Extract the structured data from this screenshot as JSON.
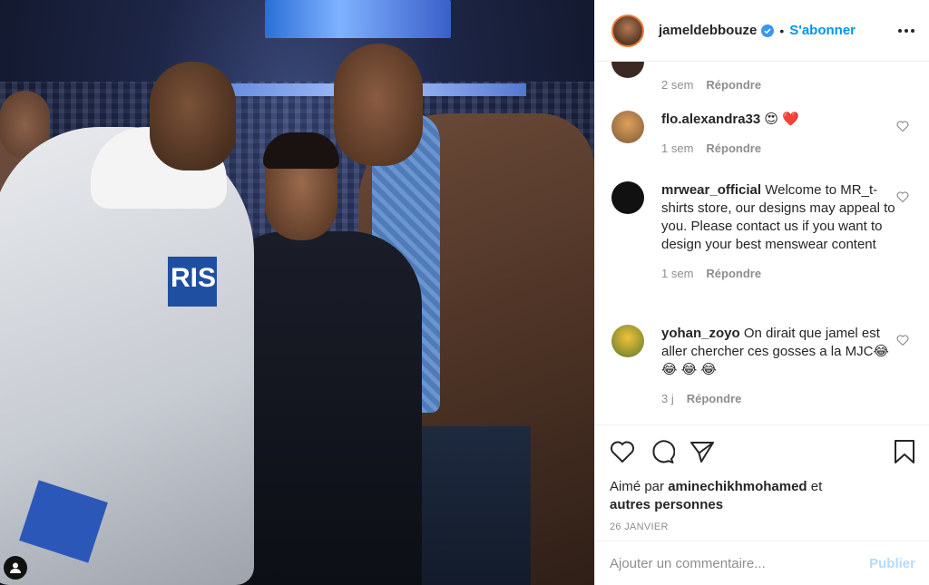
{
  "post": {
    "image_alt": "Photo de Jamel Debbouze avec deux personnes dans une arène de basketball",
    "arena_screen_text": "",
    "shirt_text": "RIS"
  },
  "header": {
    "username": "jameldebbouze",
    "verified": true,
    "separator": "•",
    "follow_label": "S'abonner",
    "more_icon": "more-horizontal-icon"
  },
  "comments": [
    {
      "username": "",
      "text": "",
      "time": "2 sem",
      "reply_label": "Répondre",
      "avatar_color": "#3a2a22"
    },
    {
      "username": "flo.alexandra33",
      "text": "😍 ❤️",
      "time": "1 sem",
      "reply_label": "Répondre",
      "avatar_color": "#c98a4a"
    },
    {
      "username": "mrwear_official",
      "text": "Welcome to MR_t-shirts store, our designs may appeal to you. Please contact us if you want to design your best menswear content",
      "time": "1 sem",
      "reply_label": "Répondre",
      "avatar_color": "#111111"
    },
    {
      "username": "yohan_zoyo",
      "text": "On dirait que jamel est aller chercher ces gosses a la MJC😂 😂 😂 😂",
      "time": "3 j",
      "reply_label": "Répondre",
      "avatar_color": "#6e8a3c"
    }
  ],
  "actions": {
    "like_icon": "heart-icon",
    "comment_icon": "comment-icon",
    "share_icon": "share-icon",
    "save_icon": "bookmark-icon"
  },
  "likes": {
    "prefix": "Aimé par",
    "user": "aminechikhmohamed",
    "middle": "et",
    "others": "autres personnes"
  },
  "date": "26 JANVIER",
  "add_comment": {
    "placeholder": "Ajouter un commentaire...",
    "publish_label": "Publier"
  },
  "colors": {
    "link_blue": "#0095f6",
    "publish_disabled": "#b3dbff",
    "meta_gray": "#8e8e8e",
    "text": "#262626",
    "heart_red": "#ed4956"
  }
}
